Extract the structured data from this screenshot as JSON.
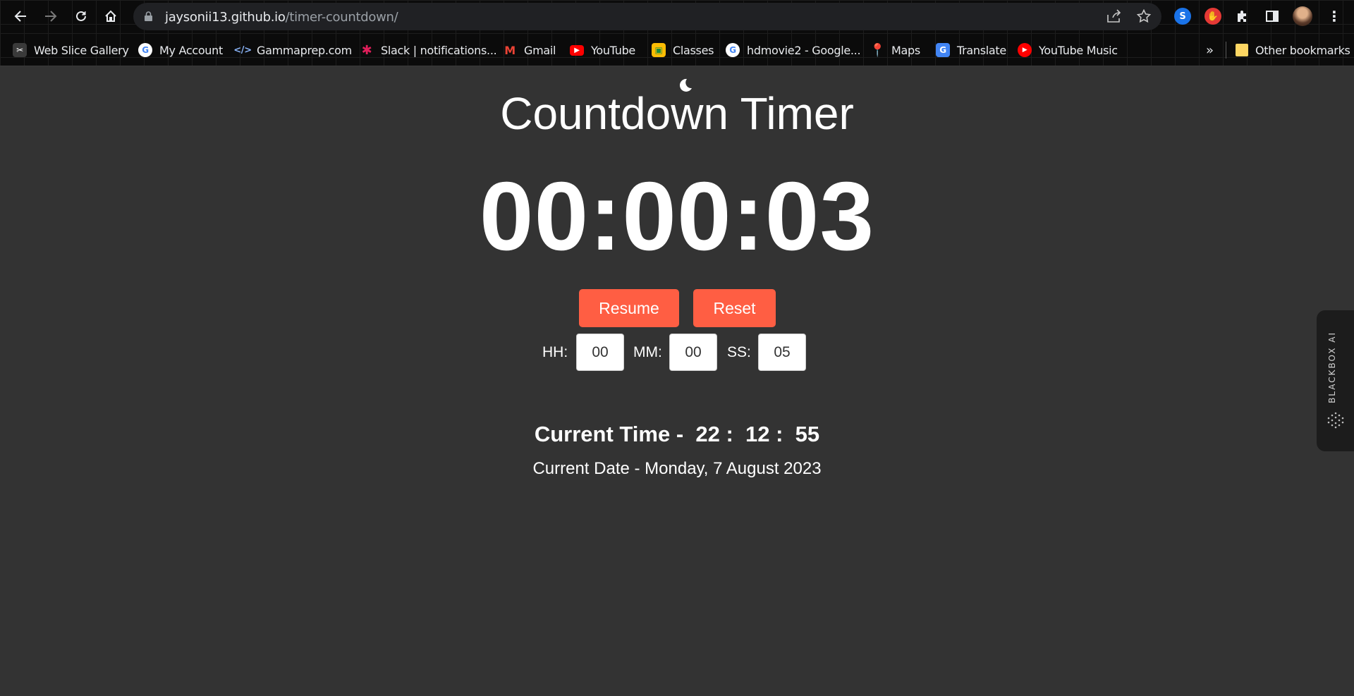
{
  "browser": {
    "url_host": "jaysonii13.github.io",
    "url_path": "/timer-countdown/"
  },
  "bookmarks": [
    {
      "label": "Web Slice Gallery",
      "icon": "web-slice-icon",
      "color": "#ffffff"
    },
    {
      "label": "My Account",
      "icon": "google-icon",
      "color": "#4285f4"
    },
    {
      "label": "Gammaprep.com",
      "icon": "code-icon",
      "color": "#8ab4f8"
    },
    {
      "label": "Slack | notifications...",
      "icon": "slack-icon",
      "color": "#e01e5a"
    },
    {
      "label": "Gmail",
      "icon": "gmail-icon",
      "color": "#ea4335"
    },
    {
      "label": "YouTube",
      "icon": "youtube-icon",
      "color": "#ff0000"
    },
    {
      "label": "Classes",
      "icon": "classroom-icon",
      "color": "#fbbc04"
    },
    {
      "label": "hdmovie2 - Google...",
      "icon": "google-icon",
      "color": "#4285f4"
    },
    {
      "label": "Maps",
      "icon": "maps-icon",
      "color": "#34a853"
    },
    {
      "label": "Translate",
      "icon": "translate-icon",
      "color": "#4285f4"
    },
    {
      "label": "YouTube Music",
      "icon": "youtube-music-icon",
      "color": "#ff0000"
    }
  ],
  "bookmarks_overflow": "»",
  "other_bookmarks": "Other bookmarks",
  "page": {
    "title": "Countdown Timer",
    "timer_display": "00:00:03",
    "resume_label": "Resume",
    "reset_label": "Reset",
    "hh_label": "HH:",
    "mm_label": "MM:",
    "ss_label": "SS:",
    "hh_value": "00",
    "mm_value": "00",
    "ss_value": "05",
    "current_time": "Current Time -  22 :  12 :  55",
    "current_date": "Current Date - Monday, 7 August 2023"
  },
  "side_tab": {
    "label": "BLACKBOX AI"
  },
  "colors": {
    "background": "#333333",
    "accent_button": "#ff5e43",
    "chrome": "#0b0b0b"
  }
}
